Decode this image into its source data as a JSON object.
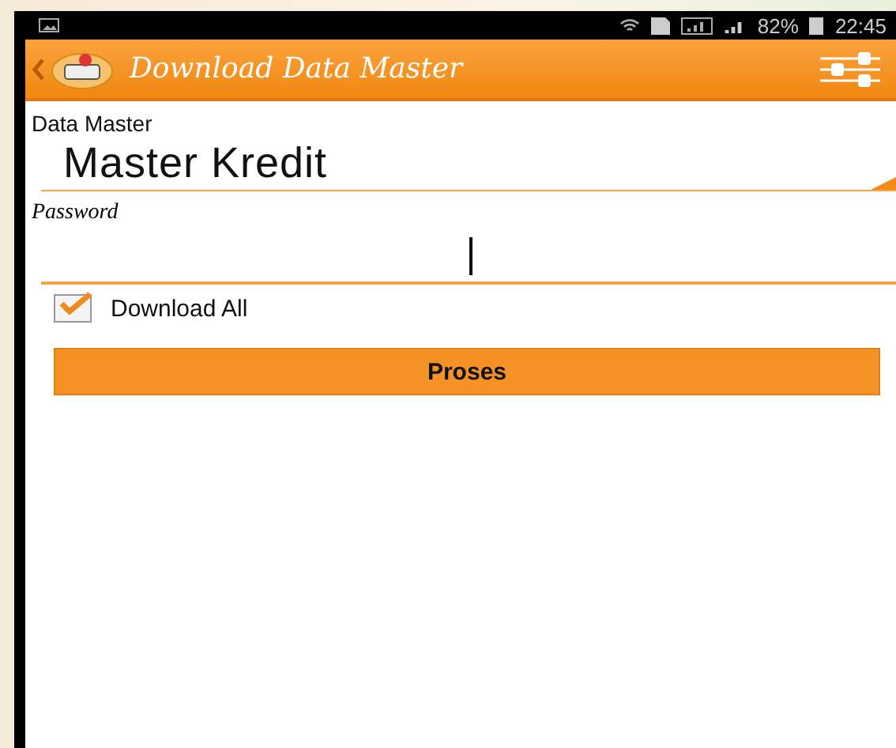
{
  "status_bar": {
    "battery": "82%",
    "time": "22:45"
  },
  "action_bar": {
    "title": "Download Data Master"
  },
  "spinner": {
    "label": "Data Master",
    "value": "Master Kredit"
  },
  "password": {
    "label": "Password",
    "focused": true
  },
  "checkbox": {
    "label": "Download All",
    "checked": true
  },
  "button": {
    "label": "Proses"
  }
}
